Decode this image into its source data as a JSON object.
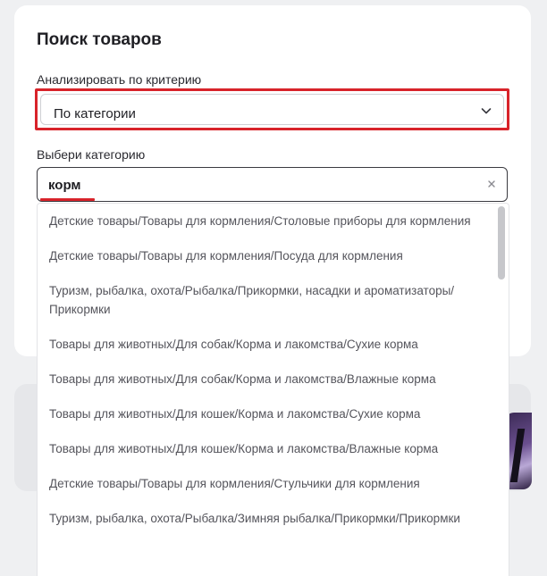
{
  "search_panel": {
    "title": "Поиск товаров",
    "criterion_label": "Анализировать по критерию",
    "criterion_value": "По категории",
    "category_label": "Выбери категорию",
    "category_query": "корм"
  },
  "dropdown": {
    "options": [
      "Детские товары/Товары для кормления/Столовые приборы для кормления",
      "Детские товары/Товары для кормления/Посуда для кормления",
      "Туризм, рыбалка, охота/Рыбалка/Прикормки, насадки и ароматизаторы/Прикормки",
      "Товары для животных/Для собак/Корма и лакомства/Сухие корма",
      "Товары для животных/Для собак/Корма и лакомства/Влажные корма",
      "Товары для животных/Для кошек/Корма и лакомства/Сухие корма",
      "Товары для животных/Для кошек/Корма и лакомства/Влажные корма",
      "Детские товары/Товары для кормления/Стульчики для кормления",
      "Туризм, рыбалка, охота/Рыбалка/Зимняя рыбалка/Прикормки/Прикормки"
    ]
  },
  "icons": {
    "select": "chevron-down-icon",
    "clear": "close-icon"
  },
  "colors": {
    "highlight_red": "#d8232a",
    "card_bg": "#ffffff",
    "page_bg": "#eff0f2"
  }
}
